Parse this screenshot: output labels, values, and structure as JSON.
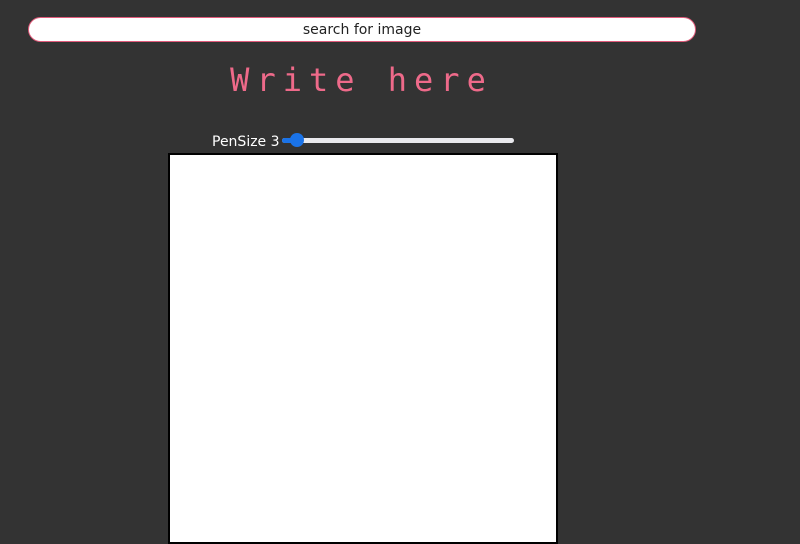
{
  "search": {
    "placeholder": "search for image",
    "border_color": "#e05a7a"
  },
  "heading": {
    "text": "Write here",
    "color": "#ee6a8a"
  },
  "pen": {
    "label": "PenSize 3",
    "value": 3,
    "min": 1,
    "max": 50,
    "accent_color": "#1a73e8"
  },
  "canvas": {
    "background": "#ffffff",
    "border_color": "#000000"
  },
  "theme": {
    "page_background": "#333333"
  }
}
